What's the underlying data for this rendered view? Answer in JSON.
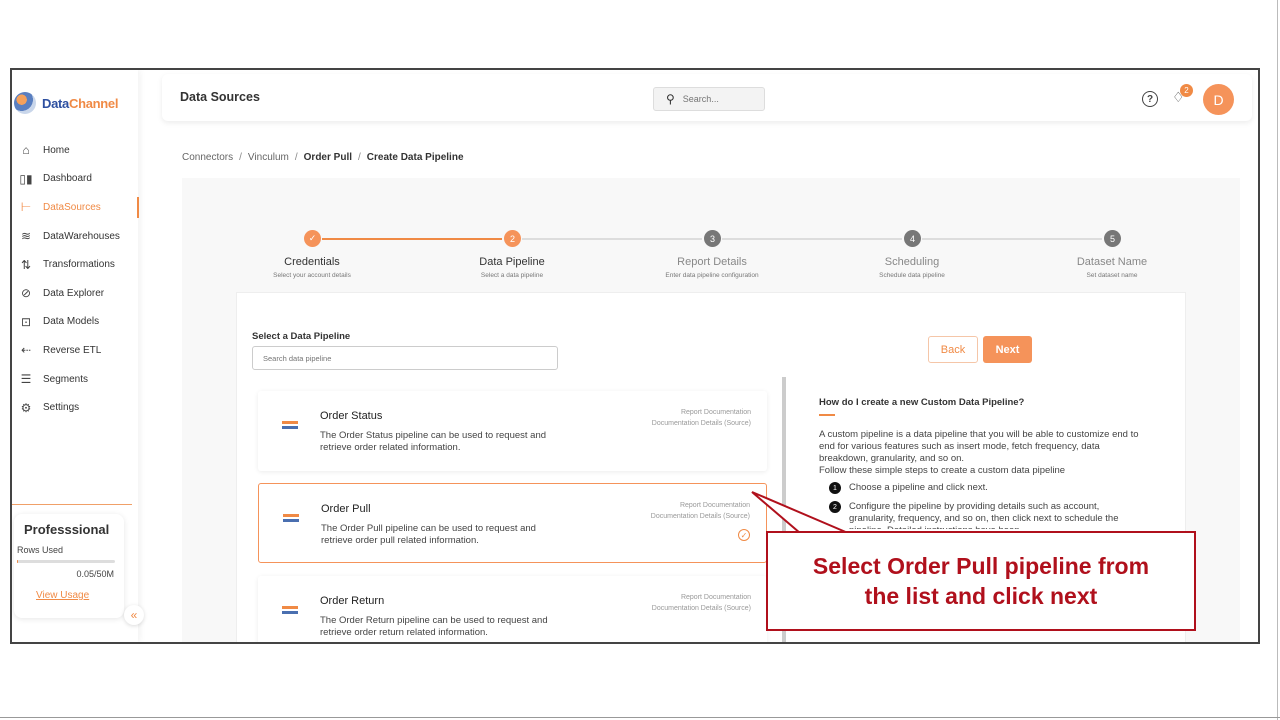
{
  "app": {
    "logo_main": "Data",
    "logo_accent": "Channel"
  },
  "sidebar": {
    "items": [
      {
        "label": "Home",
        "icon": "home-icon",
        "glyph": "⌂"
      },
      {
        "label": "Dashboard",
        "icon": "dashboard-icon",
        "glyph": "▯▮"
      },
      {
        "label": "DataSources",
        "icon": "datasources-icon",
        "glyph": "⊢",
        "active": true
      },
      {
        "label": "DataWarehouses",
        "icon": "database-icon",
        "glyph": "≋"
      },
      {
        "label": "Transformations",
        "icon": "transform-icon",
        "glyph": "⇅"
      },
      {
        "label": "Data Explorer",
        "icon": "explorer-icon",
        "glyph": "⊘"
      },
      {
        "label": "Data Models",
        "icon": "models-icon",
        "glyph": "⊡"
      },
      {
        "label": "Reverse ETL",
        "icon": "reverse-etl-icon",
        "glyph": "⇠"
      },
      {
        "label": "Segments",
        "icon": "segments-icon",
        "glyph": "☰"
      },
      {
        "label": "Settings",
        "icon": "gear-icon",
        "glyph": "⚙"
      }
    ],
    "plan": {
      "name": "Professsional",
      "rows_label": "Rows Used",
      "rows_value": "0.05/50M",
      "rows_fraction": 0.001,
      "view_usage": "View Usage"
    },
    "collapse_glyph": "«"
  },
  "header": {
    "title": "Data Sources",
    "search_placeholder": "Search...",
    "help_glyph": "?",
    "notification_count": "2",
    "avatar_letter": "D"
  },
  "breadcrumb": {
    "items": [
      "Connectors",
      "Vinculum",
      "Order Pull",
      "Create Data Pipeline"
    ],
    "sep": "/"
  },
  "stepper": {
    "steps": [
      {
        "label": "Credentials",
        "sub": "Select your account details",
        "num": "✓",
        "state": "done"
      },
      {
        "label": "Data Pipeline",
        "sub": "Select a data pipeline",
        "num": "2",
        "state": "current"
      },
      {
        "label": "Report Details",
        "sub": "Enter data pipeline configuration",
        "num": "3",
        "state": "todo"
      },
      {
        "label": "Scheduling",
        "sub": "Schedule data pipeline",
        "num": "4",
        "state": "todo"
      },
      {
        "label": "Dataset Name",
        "sub": "Set dataset name",
        "num": "5",
        "state": "todo"
      }
    ]
  },
  "pipeline": {
    "section_title": "Select a Data Pipeline",
    "search_placeholder": "Search data pipeline",
    "back_label": "Back",
    "next_label": "Next",
    "doc_link_1": "Report Documentation",
    "doc_link_2": "Documentation Details (Source)",
    "cards": [
      {
        "name": "Order Status",
        "desc": "The Order Status pipeline can be used to request and retrieve order related information.",
        "selected": false
      },
      {
        "name": "Order Pull",
        "desc": "The Order Pull pipeline can be used to request and retrieve order pull related information.",
        "selected": true
      },
      {
        "name": "Order Return",
        "desc": "The Order Return pipeline can be used to request and retrieve order return related information.",
        "selected": false
      }
    ]
  },
  "help": {
    "title": "How do I create a new Custom Data Pipeline?",
    "body": "A custom pipeline is a data pipeline that you will be able to customize end to end for various features such as insert mode, fetch frequency, data breakdown, granularity, and so on.",
    "intro": "Follow these simple steps to create a custom data pipeline",
    "steps": [
      {
        "num": "1",
        "text": "Choose a pipeline and click next."
      },
      {
        "num": "2",
        "text": "Configure the pipeline by providing details such as account, granularity, frequency, and so on, then click next to schedule the pipeline. Detailed instructions have been"
      }
    ]
  },
  "callout": {
    "line1": "Select Order Pull pipeline from",
    "line2": "the list and click next"
  },
  "chat": {
    "glyph": "…"
  },
  "colors": {
    "accent": "#f5935a",
    "callout": "#b0101c"
  }
}
